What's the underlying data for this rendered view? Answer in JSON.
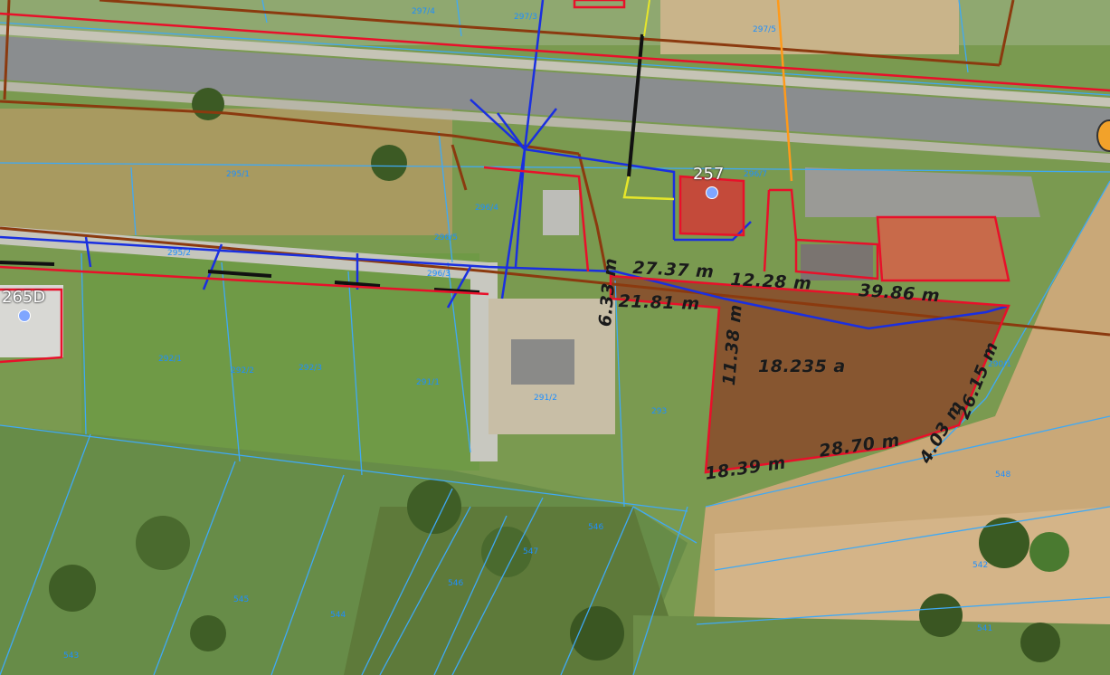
{
  "map": {
    "address_labels": [
      "257",
      "265D"
    ],
    "area_label": "18.235 a",
    "dimensions": [
      "27.37 m",
      "12.28 m",
      "39.86 m",
      "6.33 m",
      "21.81 m",
      "11.38 m",
      "26.15 m",
      "4.03 m",
      "28.70 m",
      "18.39 m"
    ],
    "parcel_numbers": [
      "297/4",
      "297/5",
      "297/3",
      "296/4",
      "296/5",
      "296/3",
      "296/7",
      "295/1",
      "295/2",
      "292/1",
      "292/2",
      "292/3",
      "291/1",
      "291/2",
      "290/1",
      "293",
      "548",
      "546",
      "547",
      "546",
      "545",
      "544",
      "543",
      "542",
      "541"
    ],
    "colors": {
      "plot_boundary": "#e8102a",
      "gas_line": "#8b3a0f",
      "water_line": "#1a2fe0",
      "parcel_lines": "#3fa9f5",
      "road": "#8a8d8f",
      "highlight_fill": "#8a4a2a"
    }
  }
}
